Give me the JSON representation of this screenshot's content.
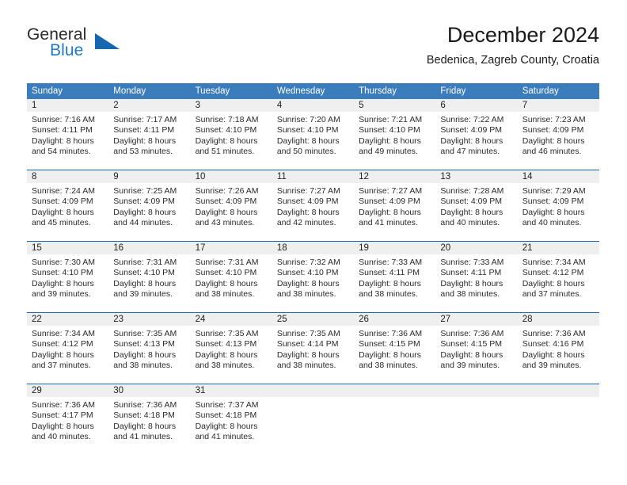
{
  "brand": {
    "name_top": "General",
    "name_bottom": "Blue",
    "triangle_icon": "blue-triangle-logo",
    "color_top": "#2b2b2b",
    "color_bottom": "#1f7ac4",
    "triangle_color": "#1667b0"
  },
  "header": {
    "title": "December 2024",
    "subtitle": "Bedenica, Zagreb County, Croatia"
  },
  "colors": {
    "header_band": "#3b7cbd",
    "week_divider": "#1667b0",
    "day_number_strip": "#efefef",
    "text": "#2a2a2a"
  },
  "weekdays": [
    "Sunday",
    "Monday",
    "Tuesday",
    "Wednesday",
    "Thursday",
    "Friday",
    "Saturday"
  ],
  "weeks": [
    [
      {
        "day": "1",
        "sunrise": "Sunrise: 7:16 AM",
        "sunset": "Sunset: 4:11 PM",
        "daylight_line1": "Daylight: 8 hours",
        "daylight_line2": "and 54 minutes."
      },
      {
        "day": "2",
        "sunrise": "Sunrise: 7:17 AM",
        "sunset": "Sunset: 4:11 PM",
        "daylight_line1": "Daylight: 8 hours",
        "daylight_line2": "and 53 minutes."
      },
      {
        "day": "3",
        "sunrise": "Sunrise: 7:18 AM",
        "sunset": "Sunset: 4:10 PM",
        "daylight_line1": "Daylight: 8 hours",
        "daylight_line2": "and 51 minutes."
      },
      {
        "day": "4",
        "sunrise": "Sunrise: 7:20 AM",
        "sunset": "Sunset: 4:10 PM",
        "daylight_line1": "Daylight: 8 hours",
        "daylight_line2": "and 50 minutes."
      },
      {
        "day": "5",
        "sunrise": "Sunrise: 7:21 AM",
        "sunset": "Sunset: 4:10 PM",
        "daylight_line1": "Daylight: 8 hours",
        "daylight_line2": "and 49 minutes."
      },
      {
        "day": "6",
        "sunrise": "Sunrise: 7:22 AM",
        "sunset": "Sunset: 4:09 PM",
        "daylight_line1": "Daylight: 8 hours",
        "daylight_line2": "and 47 minutes."
      },
      {
        "day": "7",
        "sunrise": "Sunrise: 7:23 AM",
        "sunset": "Sunset: 4:09 PM",
        "daylight_line1": "Daylight: 8 hours",
        "daylight_line2": "and 46 minutes."
      }
    ],
    [
      {
        "day": "8",
        "sunrise": "Sunrise: 7:24 AM",
        "sunset": "Sunset: 4:09 PM",
        "daylight_line1": "Daylight: 8 hours",
        "daylight_line2": "and 45 minutes."
      },
      {
        "day": "9",
        "sunrise": "Sunrise: 7:25 AM",
        "sunset": "Sunset: 4:09 PM",
        "daylight_line1": "Daylight: 8 hours",
        "daylight_line2": "and 44 minutes."
      },
      {
        "day": "10",
        "sunrise": "Sunrise: 7:26 AM",
        "sunset": "Sunset: 4:09 PM",
        "daylight_line1": "Daylight: 8 hours",
        "daylight_line2": "and 43 minutes."
      },
      {
        "day": "11",
        "sunrise": "Sunrise: 7:27 AM",
        "sunset": "Sunset: 4:09 PM",
        "daylight_line1": "Daylight: 8 hours",
        "daylight_line2": "and 42 minutes."
      },
      {
        "day": "12",
        "sunrise": "Sunrise: 7:27 AM",
        "sunset": "Sunset: 4:09 PM",
        "daylight_line1": "Daylight: 8 hours",
        "daylight_line2": "and 41 minutes."
      },
      {
        "day": "13",
        "sunrise": "Sunrise: 7:28 AM",
        "sunset": "Sunset: 4:09 PM",
        "daylight_line1": "Daylight: 8 hours",
        "daylight_line2": "and 40 minutes."
      },
      {
        "day": "14",
        "sunrise": "Sunrise: 7:29 AM",
        "sunset": "Sunset: 4:09 PM",
        "daylight_line1": "Daylight: 8 hours",
        "daylight_line2": "and 40 minutes."
      }
    ],
    [
      {
        "day": "15",
        "sunrise": "Sunrise: 7:30 AM",
        "sunset": "Sunset: 4:10 PM",
        "daylight_line1": "Daylight: 8 hours",
        "daylight_line2": "and 39 minutes."
      },
      {
        "day": "16",
        "sunrise": "Sunrise: 7:31 AM",
        "sunset": "Sunset: 4:10 PM",
        "daylight_line1": "Daylight: 8 hours",
        "daylight_line2": "and 39 minutes."
      },
      {
        "day": "17",
        "sunrise": "Sunrise: 7:31 AM",
        "sunset": "Sunset: 4:10 PM",
        "daylight_line1": "Daylight: 8 hours",
        "daylight_line2": "and 38 minutes."
      },
      {
        "day": "18",
        "sunrise": "Sunrise: 7:32 AM",
        "sunset": "Sunset: 4:10 PM",
        "daylight_line1": "Daylight: 8 hours",
        "daylight_line2": "and 38 minutes."
      },
      {
        "day": "19",
        "sunrise": "Sunrise: 7:33 AM",
        "sunset": "Sunset: 4:11 PM",
        "daylight_line1": "Daylight: 8 hours",
        "daylight_line2": "and 38 minutes."
      },
      {
        "day": "20",
        "sunrise": "Sunrise: 7:33 AM",
        "sunset": "Sunset: 4:11 PM",
        "daylight_line1": "Daylight: 8 hours",
        "daylight_line2": "and 38 minutes."
      },
      {
        "day": "21",
        "sunrise": "Sunrise: 7:34 AM",
        "sunset": "Sunset: 4:12 PM",
        "daylight_line1": "Daylight: 8 hours",
        "daylight_line2": "and 37 minutes."
      }
    ],
    [
      {
        "day": "22",
        "sunrise": "Sunrise: 7:34 AM",
        "sunset": "Sunset: 4:12 PM",
        "daylight_line1": "Daylight: 8 hours",
        "daylight_line2": "and 37 minutes."
      },
      {
        "day": "23",
        "sunrise": "Sunrise: 7:35 AM",
        "sunset": "Sunset: 4:13 PM",
        "daylight_line1": "Daylight: 8 hours",
        "daylight_line2": "and 38 minutes."
      },
      {
        "day": "24",
        "sunrise": "Sunrise: 7:35 AM",
        "sunset": "Sunset: 4:13 PM",
        "daylight_line1": "Daylight: 8 hours",
        "daylight_line2": "and 38 minutes."
      },
      {
        "day": "25",
        "sunrise": "Sunrise: 7:35 AM",
        "sunset": "Sunset: 4:14 PM",
        "daylight_line1": "Daylight: 8 hours",
        "daylight_line2": "and 38 minutes."
      },
      {
        "day": "26",
        "sunrise": "Sunrise: 7:36 AM",
        "sunset": "Sunset: 4:15 PM",
        "daylight_line1": "Daylight: 8 hours",
        "daylight_line2": "and 38 minutes."
      },
      {
        "day": "27",
        "sunrise": "Sunrise: 7:36 AM",
        "sunset": "Sunset: 4:15 PM",
        "daylight_line1": "Daylight: 8 hours",
        "daylight_line2": "and 39 minutes."
      },
      {
        "day": "28",
        "sunrise": "Sunrise: 7:36 AM",
        "sunset": "Sunset: 4:16 PM",
        "daylight_line1": "Daylight: 8 hours",
        "daylight_line2": "and 39 minutes."
      }
    ],
    [
      {
        "day": "29",
        "sunrise": "Sunrise: 7:36 AM",
        "sunset": "Sunset: 4:17 PM",
        "daylight_line1": "Daylight: 8 hours",
        "daylight_line2": "and 40 minutes."
      },
      {
        "day": "30",
        "sunrise": "Sunrise: 7:36 AM",
        "sunset": "Sunset: 4:18 PM",
        "daylight_line1": "Daylight: 8 hours",
        "daylight_line2": "and 41 minutes."
      },
      {
        "day": "31",
        "sunrise": "Sunrise: 7:37 AM",
        "sunset": "Sunset: 4:18 PM",
        "daylight_line1": "Daylight: 8 hours",
        "daylight_line2": "and 41 minutes."
      },
      {
        "day": "",
        "sunrise": "",
        "sunset": "",
        "daylight_line1": "",
        "daylight_line2": ""
      },
      {
        "day": "",
        "sunrise": "",
        "sunset": "",
        "daylight_line1": "",
        "daylight_line2": ""
      },
      {
        "day": "",
        "sunrise": "",
        "sunset": "",
        "daylight_line1": "",
        "daylight_line2": ""
      },
      {
        "day": "",
        "sunrise": "",
        "sunset": "",
        "daylight_line1": "",
        "daylight_line2": ""
      }
    ]
  ]
}
